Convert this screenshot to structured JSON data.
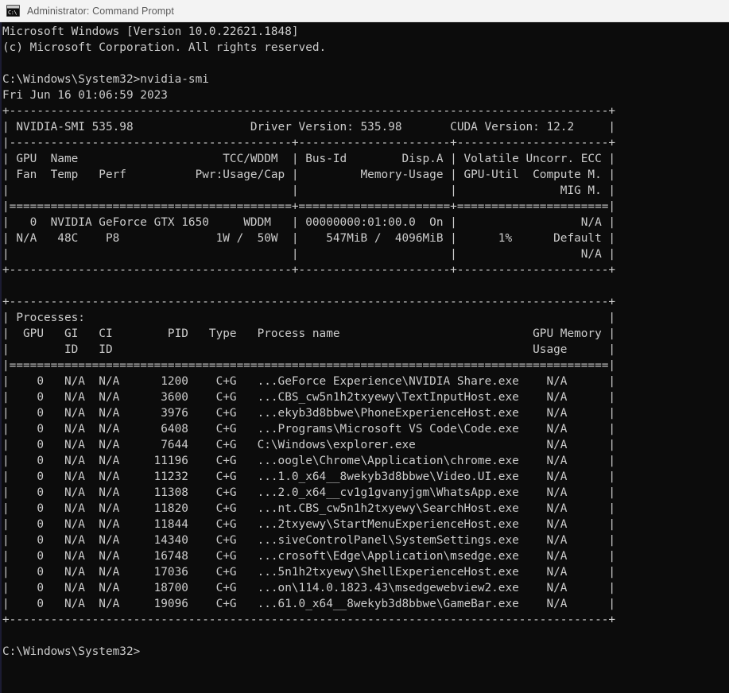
{
  "window": {
    "title": "Administrator: Command Prompt",
    "icon": "cmd-console-icon",
    "icon_text": "C:\\",
    "titlebar_bg": "#f3f3f3",
    "titlebar_fg": "#5a5a5a",
    "console_bg": "#0c0c0c",
    "console_fg": "#cccccc"
  },
  "console": {
    "banner": [
      "Microsoft Windows [Version 10.0.22621.1848]",
      "(c) Microsoft Corporation. All rights reserved."
    ],
    "prompt_path": "C:\\Windows\\System32>",
    "command": "nvidia-smi",
    "timestamp": "Fri Jun 16 01:06:59 2023",
    "final_prompt": "C:\\Windows\\System32>",
    "nvidia_smi": {
      "header": {
        "smi_version_label": "NVIDIA-SMI 535.98",
        "driver_version_label": "Driver Version: 535.98",
        "cuda_version_label": "CUDA Version: 12.2"
      },
      "gpu_table": {
        "headers_line1": [
          "GPU",
          "Name",
          "TCC/WDDM",
          "Bus-Id",
          "Disp.A",
          "Volatile Uncorr. ECC"
        ],
        "headers_line2": [
          "Fan",
          "Temp",
          "Perf",
          "Pwr:Usage/Cap",
          "Memory-Usage",
          "GPU-Util",
          "Compute M."
        ],
        "headers_line3": [
          "MIG M."
        ],
        "rows": [
          {
            "gpu": "0",
            "name": "NVIDIA GeForce GTX 1650",
            "tcc_wddm": "WDDM",
            "bus_id": "00000000:01:00.0",
            "disp_a": "On",
            "ecc": "N/A",
            "fan": "N/A",
            "temp": "48C",
            "perf": "P8",
            "pwr_usage_cap": "1W /  50W",
            "memory_usage": "547MiB /  4096MiB",
            "gpu_util": "1%",
            "compute_m": "Default",
            "mig_m": "N/A"
          }
        ]
      },
      "processes_table": {
        "section_label": "Processes:",
        "headers_line1": [
          "GPU",
          "GI",
          "CI",
          "PID",
          "Type",
          "Process name",
          "GPU Memory"
        ],
        "headers_line2": [
          "ID",
          "ID",
          "Usage"
        ],
        "rows": [
          {
            "gpu": "0",
            "gi_id": "N/A",
            "ci_id": "N/A",
            "pid": "1200",
            "type": "C+G",
            "process_name": "...GeForce Experience\\NVIDIA Share.exe",
            "gpu_memory_usage": "N/A"
          },
          {
            "gpu": "0",
            "gi_id": "N/A",
            "ci_id": "N/A",
            "pid": "3600",
            "type": "C+G",
            "process_name": "...CBS_cw5n1h2txyewy\\TextInputHost.exe",
            "gpu_memory_usage": "N/A"
          },
          {
            "gpu": "0",
            "gi_id": "N/A",
            "ci_id": "N/A",
            "pid": "3976",
            "type": "C+G",
            "process_name": "...ekyb3d8bbwe\\PhoneExperienceHost.exe",
            "gpu_memory_usage": "N/A"
          },
          {
            "gpu": "0",
            "gi_id": "N/A",
            "ci_id": "N/A",
            "pid": "6408",
            "type": "C+G",
            "process_name": "...Programs\\Microsoft VS Code\\Code.exe",
            "gpu_memory_usage": "N/A"
          },
          {
            "gpu": "0",
            "gi_id": "N/A",
            "ci_id": "N/A",
            "pid": "7644",
            "type": "C+G",
            "process_name": "C:\\Windows\\explorer.exe",
            "gpu_memory_usage": "N/A"
          },
          {
            "gpu": "0",
            "gi_id": "N/A",
            "ci_id": "N/A",
            "pid": "11196",
            "type": "C+G",
            "process_name": "...oogle\\Chrome\\Application\\chrome.exe",
            "gpu_memory_usage": "N/A"
          },
          {
            "gpu": "0",
            "gi_id": "N/A",
            "ci_id": "N/A",
            "pid": "11232",
            "type": "C+G",
            "process_name": "...1.0_x64__8wekyb3d8bbwe\\Video.UI.exe",
            "gpu_memory_usage": "N/A"
          },
          {
            "gpu": "0",
            "gi_id": "N/A",
            "ci_id": "N/A",
            "pid": "11308",
            "type": "C+G",
            "process_name": "...2.0_x64__cv1g1gvanyjgm\\WhatsApp.exe",
            "gpu_memory_usage": "N/A"
          },
          {
            "gpu": "0",
            "gi_id": "N/A",
            "ci_id": "N/A",
            "pid": "11820",
            "type": "C+G",
            "process_name": "...nt.CBS_cw5n1h2txyewy\\SearchHost.exe",
            "gpu_memory_usage": "N/A"
          },
          {
            "gpu": "0",
            "gi_id": "N/A",
            "ci_id": "N/A",
            "pid": "11844",
            "type": "C+G",
            "process_name": "...2txyewy\\StartMenuExperienceHost.exe",
            "gpu_memory_usage": "N/A"
          },
          {
            "gpu": "0",
            "gi_id": "N/A",
            "ci_id": "N/A",
            "pid": "14340",
            "type": "C+G",
            "process_name": "...siveControlPanel\\SystemSettings.exe",
            "gpu_memory_usage": "N/A"
          },
          {
            "gpu": "0",
            "gi_id": "N/A",
            "ci_id": "N/A",
            "pid": "16748",
            "type": "C+G",
            "process_name": "...crosoft\\Edge\\Application\\msedge.exe",
            "gpu_memory_usage": "N/A"
          },
          {
            "gpu": "0",
            "gi_id": "N/A",
            "ci_id": "N/A",
            "pid": "17036",
            "type": "C+G",
            "process_name": "...5n1h2txyewy\\ShellExperienceHost.exe",
            "gpu_memory_usage": "N/A"
          },
          {
            "gpu": "0",
            "gi_id": "N/A",
            "ci_id": "N/A",
            "pid": "18700",
            "type": "C+G",
            "process_name": "...on\\114.0.1823.43\\msedgewebview2.exe",
            "gpu_memory_usage": "N/A"
          },
          {
            "gpu": "0",
            "gi_id": "N/A",
            "ci_id": "N/A",
            "pid": "19096",
            "type": "C+G",
            "process_name": "...61.0_x64__8wekyb3d8bbwe\\GameBar.exe",
            "gpu_memory_usage": "N/A"
          }
        ]
      }
    },
    "full_text": "Microsoft Windows [Version 10.0.22621.1848]\n(c) Microsoft Corporation. All rights reserved.\n\nC:\\Windows\\System32>nvidia-smi\nFri Jun 16 01:06:59 2023\n+---------------------------------------------------------------------------------------+\n| NVIDIA-SMI 535.98                 Driver Version: 535.98       CUDA Version: 12.2     |\n|-----------------------------------------+----------------------+----------------------+\n| GPU  Name                     TCC/WDDM  | Bus-Id        Disp.A | Volatile Uncorr. ECC |\n| Fan  Temp   Perf          Pwr:Usage/Cap |         Memory-Usage | GPU-Util  Compute M. |\n|                                         |                      |               MIG M. |\n|=========================================+======================+======================|\n|   0  NVIDIA GeForce GTX 1650     WDDM   | 00000000:01:00.0  On |                  N/A |\n| N/A   48C    P8              1W /  50W  |    547MiB /  4096MiB |      1%      Default |\n|                                         |                      |                  N/A |\n+-----------------------------------------+----------------------+----------------------+\n                                                                                         \n+---------------------------------------------------------------------------------------+\n| Processes:                                                                            |\n|  GPU   GI   CI        PID   Type   Process name                            GPU Memory |\n|        ID   ID                                                             Usage      |\n|=======================================================================================|\n|    0   N/A  N/A      1200    C+G   ...GeForce Experience\\NVIDIA Share.exe    N/A      |\n|    0   N/A  N/A      3600    C+G   ...CBS_cw5n1h2txyewy\\TextInputHost.exe    N/A      |\n|    0   N/A  N/A      3976    C+G   ...ekyb3d8bbwe\\PhoneExperienceHost.exe    N/A      |\n|    0   N/A  N/A      6408    C+G   ...Programs\\Microsoft VS Code\\Code.exe    N/A      |\n|    0   N/A  N/A      7644    C+G   C:\\Windows\\explorer.exe                   N/A      |\n|    0   N/A  N/A     11196    C+G   ...oogle\\Chrome\\Application\\chrome.exe    N/A      |\n|    0   N/A  N/A     11232    C+G   ...1.0_x64__8wekyb3d8bbwe\\Video.UI.exe    N/A      |\n|    0   N/A  N/A     11308    C+G   ...2.0_x64__cv1g1gvanyjgm\\WhatsApp.exe    N/A      |\n|    0   N/A  N/A     11820    C+G   ...nt.CBS_cw5n1h2txyewy\\SearchHost.exe    N/A      |\n|    0   N/A  N/A     11844    C+G   ...2txyewy\\StartMenuExperienceHost.exe    N/A      |\n|    0   N/A  N/A     14340    C+G   ...siveControlPanel\\SystemSettings.exe    N/A      |\n|    0   N/A  N/A     16748    C+G   ...crosoft\\Edge\\Application\\msedge.exe    N/A      |\n|    0   N/A  N/A     17036    C+G   ...5n1h2txyewy\\ShellExperienceHost.exe    N/A      |\n|    0   N/A  N/A     18700    C+G   ...on\\114.0.1823.43\\msedgewebview2.exe    N/A      |\n|    0   N/A  N/A     19096    C+G   ...61.0_x64__8wekyb3d8bbwe\\GameBar.exe    N/A      |\n+---------------------------------------------------------------------------------------+\n\nC:\\Windows\\System32>"
  }
}
